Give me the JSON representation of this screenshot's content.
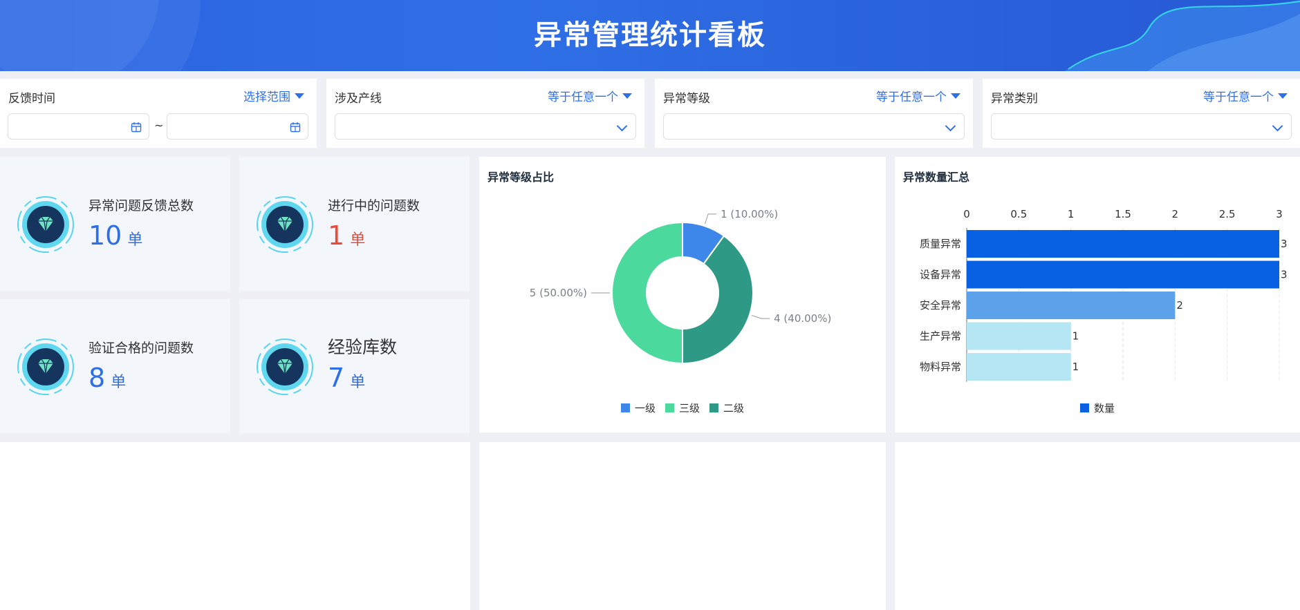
{
  "header": {
    "title": "异常管理统计看板"
  },
  "filters": [
    {
      "label": "反馈时间",
      "operator": "选择范围",
      "type": "daterange"
    },
    {
      "label": "涉及产线",
      "operator": "等于任意一个",
      "type": "select"
    },
    {
      "label": "异常等级",
      "operator": "等于任意一个",
      "type": "select"
    },
    {
      "label": "异常类别",
      "operator": "等于任意一个",
      "type": "select"
    }
  ],
  "date_separator": "~",
  "stats": [
    {
      "label": "异常问题反馈总数",
      "value": "10",
      "unit": "单"
    },
    {
      "label": "进行中的问题数",
      "value": "1",
      "unit": "单"
    },
    {
      "label": "验证合格的问题数",
      "value": "8",
      "unit": "单"
    },
    {
      "label": "经验库数",
      "value": "7",
      "unit": "单"
    }
  ],
  "colors": {
    "accent": "#2f6fe6",
    "red": "#e84b3c",
    "level1": "#3d86ea",
    "level3": "#4cd99e",
    "level2": "#2e9a85",
    "bar_dark": "#0860e3",
    "bar_mid": "#5ba2ea",
    "bar_light": "#b4e6f3"
  },
  "chart_data": [
    {
      "type": "pie",
      "title": "异常等级占比",
      "donut": true,
      "categories": [
        "一级",
        "三级",
        "二级"
      ],
      "values": [
        1,
        5,
        4
      ],
      "labels": [
        "1 (10.00%)",
        "5 (50.00%)",
        "4 (40.00%)"
      ],
      "legend": [
        "一级",
        "三级",
        "二级"
      ],
      "legend_position": "bottom"
    },
    {
      "type": "bar",
      "orientation": "horizontal",
      "title": "异常数量汇总",
      "categories": [
        "质量异常",
        "设备异常",
        "安全异常",
        "生产异常",
        "物料异常"
      ],
      "series": [
        {
          "name": "数量",
          "values": [
            3,
            3,
            2,
            1,
            1
          ]
        }
      ],
      "xlim": [
        0,
        3
      ],
      "x_ticks": [
        "0",
        "0.5",
        "1",
        "1.5",
        "2",
        "2.5",
        "3"
      ],
      "x_axis_position": "top",
      "grid": true,
      "legend_position": "bottom"
    }
  ]
}
